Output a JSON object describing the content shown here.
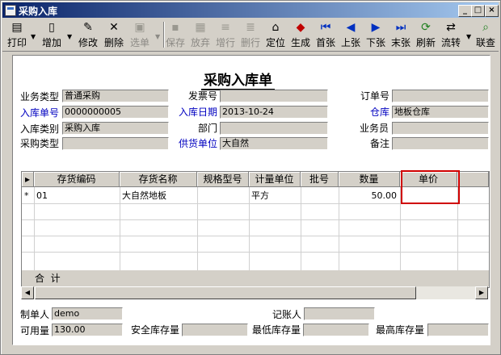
{
  "window": {
    "title": "采购入库"
  },
  "toolbar": {
    "items": [
      {
        "label": "打印",
        "icon": "printer-icon",
        "enabled": true
      },
      {
        "label": "增加",
        "icon": "add-icon",
        "enabled": true
      },
      {
        "label": "修改",
        "icon": "edit-icon",
        "enabled": true
      },
      {
        "label": "删除",
        "icon": "delete-icon",
        "enabled": true
      },
      {
        "label": "选单",
        "icon": "select-list-icon",
        "enabled": false
      },
      {
        "label": "保存",
        "icon": "save-icon",
        "enabled": false
      },
      {
        "label": "放弃",
        "icon": "discard-icon",
        "enabled": false
      },
      {
        "label": "增行",
        "icon": "add-row-icon",
        "enabled": false
      },
      {
        "label": "删行",
        "icon": "delete-row-icon",
        "enabled": false
      },
      {
        "label": "定位",
        "icon": "locate-icon",
        "enabled": true
      },
      {
        "label": "生成",
        "icon": "generate-icon",
        "enabled": true
      },
      {
        "label": "首张",
        "icon": "first-icon",
        "enabled": true
      },
      {
        "label": "上张",
        "icon": "prev-icon",
        "enabled": true
      },
      {
        "label": "下张",
        "icon": "next-icon",
        "enabled": true
      },
      {
        "label": "末张",
        "icon": "last-icon",
        "enabled": true
      },
      {
        "label": "刷新",
        "icon": "refresh-icon",
        "enabled": true
      },
      {
        "label": "流转",
        "icon": "flow-icon",
        "enabled": true
      },
      {
        "label": "联查",
        "icon": "query-icon",
        "enabled": true
      }
    ]
  },
  "doc": {
    "title": "采购入库单"
  },
  "header": {
    "biz_type": {
      "label": "业务类型",
      "value": "普通采购"
    },
    "invoice_no": {
      "label": "发票号",
      "value": ""
    },
    "order_no": {
      "label": "订单号",
      "value": ""
    },
    "inbound_no": {
      "label": "入库单号",
      "value": "0000000005"
    },
    "inbound_date": {
      "label": "入库日期",
      "value": "2013-10-24"
    },
    "warehouse": {
      "label": "仓库",
      "value": "地板仓库"
    },
    "inbound_category": {
      "label": "入库类别",
      "value": "采购入库"
    },
    "department": {
      "label": "部门",
      "value": ""
    },
    "salesperson": {
      "label": "业务员",
      "value": ""
    },
    "purchase_type": {
      "label": "采购类型",
      "value": ""
    },
    "supplier": {
      "label": "供货单位",
      "value": "大自然"
    },
    "remark": {
      "label": "备注",
      "value": ""
    }
  },
  "grid": {
    "columns": [
      "存货编码",
      "存货名称",
      "规格型号",
      "计量单位",
      "批号",
      "数量",
      "单价"
    ],
    "rows": [
      {
        "marker": "*",
        "code": "01",
        "name": "大自然地板",
        "spec": "",
        "unit": "平方",
        "batch": "",
        "qty": "50.00",
        "price": ""
      }
    ],
    "total_label": "合  计"
  },
  "footer": {
    "creator": {
      "label": "制单人",
      "value": "demo"
    },
    "bookkeeper": {
      "label": "记账人",
      "value": ""
    },
    "available_qty": {
      "label": "可用量",
      "value": "130.00"
    },
    "safety_stock": {
      "label": "安全库存量",
      "value": ""
    },
    "min_stock": {
      "label": "最低库存量",
      "value": ""
    },
    "max_stock": {
      "label": "最高库存量",
      "value": ""
    }
  }
}
